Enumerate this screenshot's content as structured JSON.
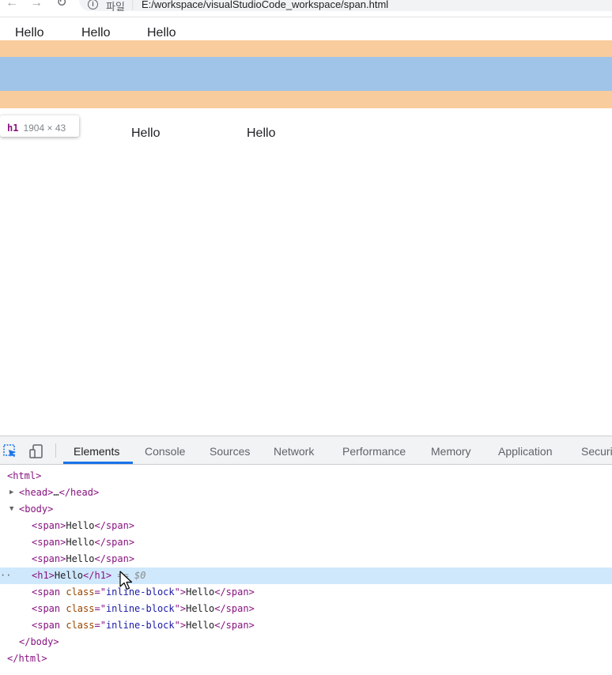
{
  "browser": {
    "scheme": "파일",
    "separator": "|",
    "url": "E:/workspace/visualStudioCode_workspace/span.html"
  },
  "page": {
    "spans": [
      "Hello",
      "Hello",
      "Hello"
    ],
    "inline_block_spans": [
      "Hello",
      "Hello"
    ]
  },
  "tooltip": {
    "tag": "h1",
    "dims": "1904 × 43"
  },
  "colors": {
    "margin": "#f9cc9d",
    "content": "#9fc4e7",
    "selected_row": "#cfe8fc",
    "active_tab": "#1a73e8"
  },
  "devtools": {
    "tabs": [
      "Elements",
      "Console",
      "Sources",
      "Network",
      "Performance",
      "Memory",
      "Application",
      "Securi"
    ],
    "active_tab": "Elements",
    "dom": {
      "html_open": "<html>",
      "head_open": "<head>",
      "head_ellipsis": "…",
      "head_close": "</head>",
      "body_open": "<body>",
      "span_open": "<span>",
      "span_close": "</span>",
      "hello": "Hello",
      "h1_open": "<h1>",
      "h1_close": "</h1>",
      "selected_marker": " == $0",
      "span_class_open": "<span ",
      "class_attr": "class",
      "class_eq": "=\"",
      "class_value": "inline-block",
      "class_end": "\">",
      "body_close": "</body>",
      "html_close": "</html>",
      "row_dots": "··"
    }
  }
}
